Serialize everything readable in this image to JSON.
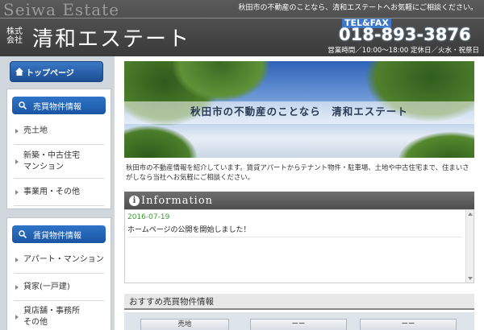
{
  "header": {
    "brand_en": "Seiwa Estate",
    "tagline": "秋田市の不動産のことなら、清和エステートへお気軽にご相談ください。",
    "brand_kabushiki": "株式会社",
    "brand_jp": "清和エステート",
    "tel_label": "TEL&FAX",
    "tel_number": "018-893-3876",
    "hours": "営業時間／10:00～18:00  定休日／火水・祝祭日"
  },
  "sidebar": {
    "top_button": "トップページ",
    "sale_panel": {
      "heading": "売買物件情報",
      "items": [
        {
          "label": "売土地"
        },
        {
          "label": "新築・中古住宅\nマンション"
        },
        {
          "label": "事業用・その他"
        }
      ]
    },
    "rent_panel": {
      "heading": "賃貸物件情報",
      "items": [
        {
          "label": "アパート・マンション"
        },
        {
          "label": "貸家(一戸建)"
        },
        {
          "label": "貸店舗・事務所\nその他"
        }
      ]
    }
  },
  "main": {
    "hero_text": "秋田市の不動産のことなら　清和エステート",
    "intro": "秋田市の不動産情報を紹介しています。賃貸アパートからテナント物件・駐車場、土地や中古住宅まで、住まいさがしなら当社へお気軽にご相談ください。",
    "information": {
      "title": "Information",
      "entries": [
        {
          "date": "2016-07-19",
          "message": "ホームページの公開を開始しました！"
        }
      ]
    },
    "recommend": {
      "title": "おすすめ売買物件情報",
      "cards": [
        "売地",
        "ーー",
        "ーー"
      ]
    }
  },
  "colors": {
    "header_bg": "#4a4a4a",
    "accent_blue": "#2a68b8",
    "info_date_green": "#3a9a34",
    "page_bg": "#cfd6dc"
  }
}
